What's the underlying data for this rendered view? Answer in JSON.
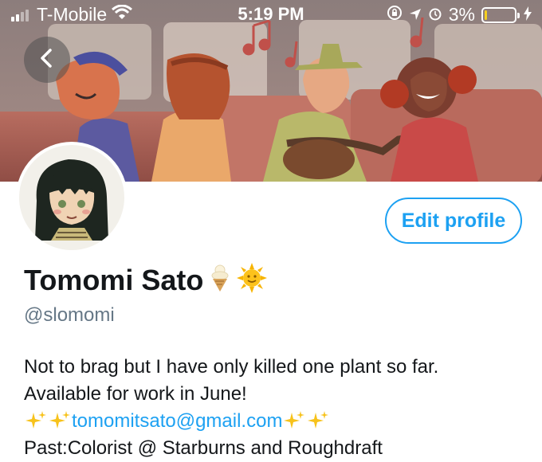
{
  "status_bar": {
    "carrier": "T-Mobile",
    "time": "5:19 PM",
    "battery_percent": "3%",
    "battery_level": 0.03,
    "icons": [
      "signal-icon",
      "wifi-icon",
      "orientation-lock-icon",
      "location-icon",
      "alarm-icon",
      "battery-icon",
      "charging-icon"
    ]
  },
  "header": {
    "back_icon": "chevron-left-icon"
  },
  "profile": {
    "display_name": "Tomomi Sato",
    "name_emojis": [
      "ice-cream-icon",
      "sun-icon"
    ],
    "handle": "@slomomi",
    "edit_profile_label": "Edit profile",
    "bio": {
      "line1": "Not to brag but I have only killed one plant so far.",
      "line2": "Available for work in June!",
      "email": "tomomitsato@gmail.com",
      "line4": "Past:Colorist @ Starburns and Roughdraft"
    }
  },
  "colors": {
    "accent": "#1da1f2",
    "text_primary": "#14171a",
    "text_secondary": "#657786"
  }
}
